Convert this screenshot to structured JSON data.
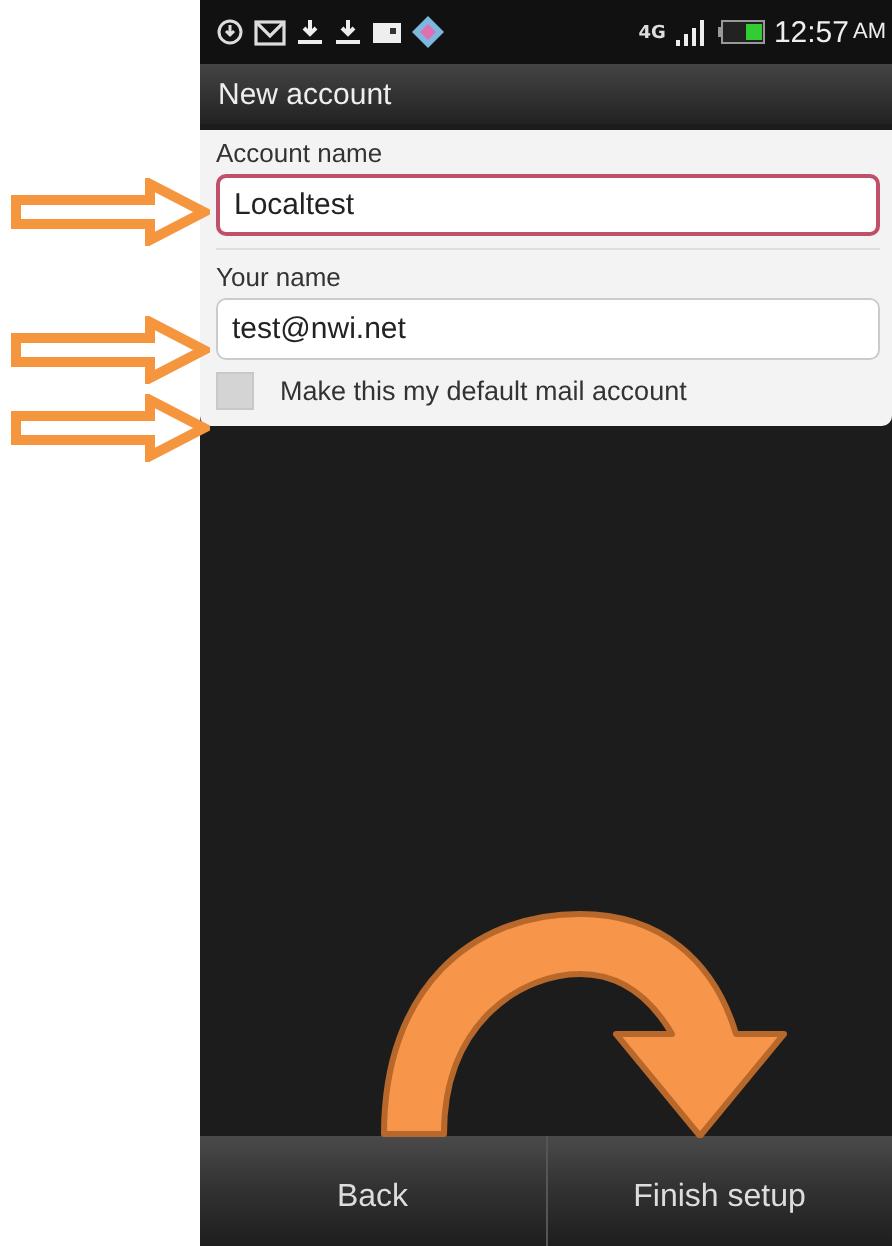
{
  "status_bar": {
    "network": "4G",
    "time": "12:57",
    "am_pm": "AM"
  },
  "title_bar": {
    "title": "New account"
  },
  "fields": [
    {
      "label": "Account name",
      "value": "Localtest",
      "focused": true
    },
    {
      "label": "Your name",
      "value": "test@nwi.net",
      "focused": false
    }
  ],
  "default_account": {
    "label": "Make this my default mail account",
    "checked": false
  },
  "buttons": [
    {
      "label": "Back"
    },
    {
      "label": "Finish setup"
    }
  ]
}
